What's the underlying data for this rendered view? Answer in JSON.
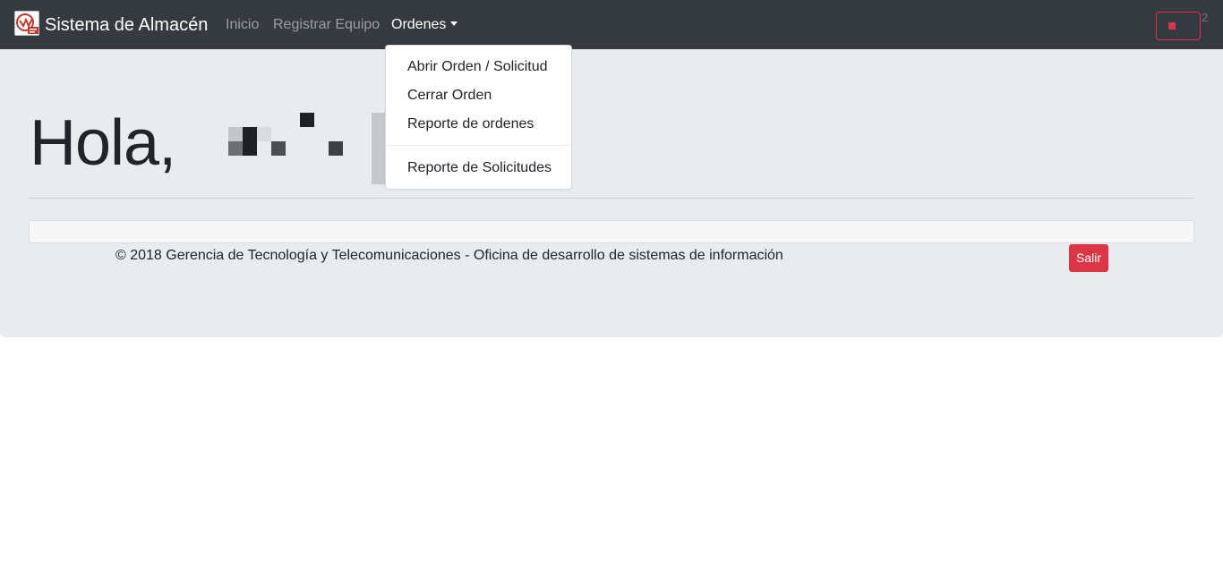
{
  "navbar": {
    "brand": "Sistema de Almacén",
    "links": [
      {
        "label": "Inicio"
      },
      {
        "label": "Registrar Equipo"
      },
      {
        "label": "Ordenes"
      }
    ],
    "user_number": "2",
    "colors": {
      "background": "#343a40",
      "danger": "#dc3545"
    }
  },
  "dropdown": {
    "items": [
      {
        "label": "Abrir Orden / Solicitud"
      },
      {
        "label": "Cerrar Orden"
      },
      {
        "label": "Reporte de ordenes"
      },
      {
        "label": "Reporte de Solicitudes"
      }
    ]
  },
  "main": {
    "greeting": "Hola,",
    "copyright": "© 2018 Gerencia de Tecnología y Telecomunicaciones - Oficina de desarrollo de sistemas de información",
    "logout_label": "Salir",
    "colors": {
      "background": "#e9ecef"
    }
  }
}
